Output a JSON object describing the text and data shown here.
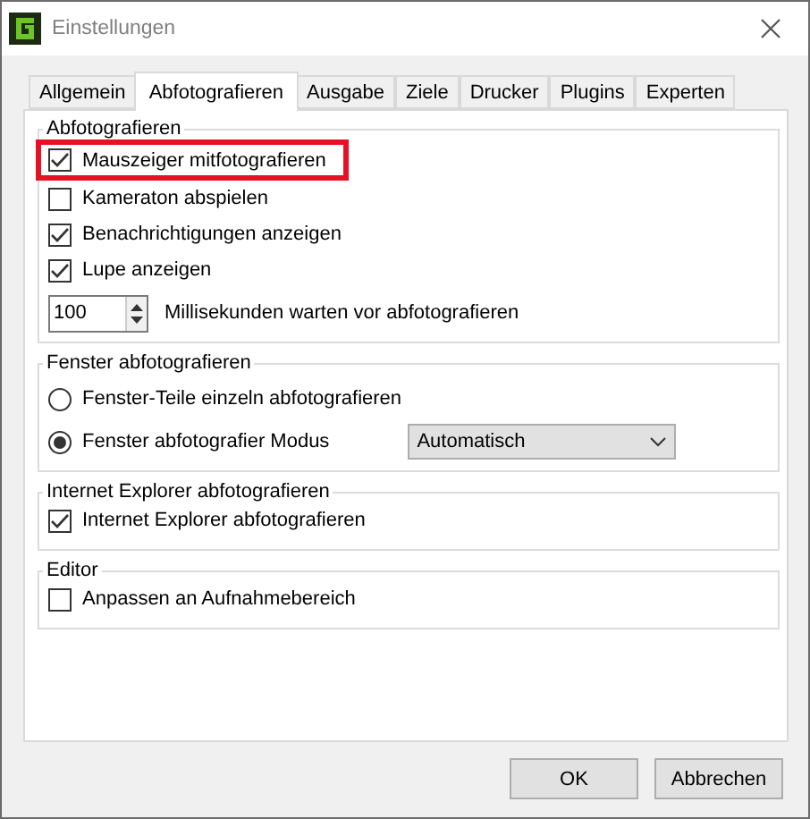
{
  "window": {
    "title": "Einstellungen"
  },
  "tabs": [
    {
      "label": "Allgemein",
      "selected": false
    },
    {
      "label": "Abfotografieren",
      "selected": true
    },
    {
      "label": "Ausgabe",
      "selected": false
    },
    {
      "label": "Ziele",
      "selected": false
    },
    {
      "label": "Drucker",
      "selected": false
    },
    {
      "label": "Plugins",
      "selected": false
    },
    {
      "label": "Experten",
      "selected": false
    }
  ],
  "groups": [
    {
      "title": "Abfotografieren",
      "items": [
        {
          "kind": "checkbox",
          "label": "Mauszeiger mitfotografieren",
          "checked": true,
          "highlighted": true
        },
        {
          "kind": "checkbox",
          "label": "Kameraton abspielen",
          "checked": false,
          "highlighted": false
        },
        {
          "kind": "checkbox",
          "label": "Benachrichtigungen anzeigen",
          "checked": true,
          "highlighted": false
        },
        {
          "kind": "checkbox",
          "label": "Lupe anzeigen",
          "checked": true,
          "highlighted": false
        },
        {
          "kind": "spinner",
          "number": "100",
          "label": "Millisekunden warten vor abfotografieren",
          "highlighted": false
        }
      ]
    },
    {
      "title": "Fenster abfotografieren",
      "items": [
        {
          "kind": "radio",
          "label": "Fenster-Teile einzeln abfotografieren",
          "selected": false,
          "highlighted": false
        },
        {
          "kind": "radio",
          "label": "Fenster abfotografier Modus",
          "selected": true,
          "highlighted": false,
          "dropdown": {
            "value": "Automatisch"
          }
        }
      ]
    },
    {
      "title": "Internet Explorer abfotografieren",
      "items": [
        {
          "kind": "checkbox",
          "label": "Internet Explorer abfotografieren",
          "checked": true,
          "highlighted": false
        }
      ]
    },
    {
      "title": "Editor",
      "items": [
        {
          "kind": "checkbox",
          "label": "Anpassen an Aufnahmebereich",
          "checked": false,
          "highlighted": false
        }
      ]
    }
  ],
  "buttons": [
    "OK",
    "Abbrechen"
  ]
}
